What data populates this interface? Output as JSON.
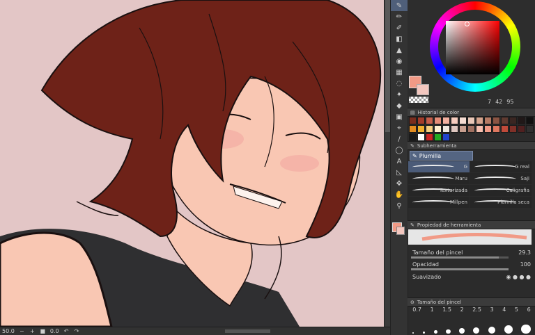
{
  "canvas": {
    "background": "#e3c6c6",
    "hair_color": "#6e2218",
    "skin_color": "#f9c7b3",
    "shirt_color": "#2f2f31"
  },
  "statusbar": {
    "zoom": "50.0",
    "angle": "0.0"
  },
  "color_panel": {
    "main_color": "#f19a86",
    "sub_color": "#f3c7bf",
    "h": "7",
    "s": "42",
    "v": "95"
  },
  "color_history": {
    "title": "Historial de color",
    "swatches": [
      "#7a2d1e",
      "#a23c2a",
      "#c65f4b",
      "#e48c77",
      "#f2b0a0",
      "#f7cdbf",
      "#f5dcd2",
      "#e9c7b7",
      "#d6a58e",
      "#b47a64",
      "#8a5443",
      "#5f3a30",
      "#3a2622",
      "#201818",
      "#111111",
      "#e38c20",
      "#f0b030",
      "#f6d080",
      "#fff0d0",
      "#f0e8e0",
      "#e0c8c0",
      "#c9a090",
      "#a07060",
      "#f7c0b0",
      "#f19a86",
      "#e07860",
      "#c04a3a",
      "#803028",
      "#502020",
      "#303030",
      "#1a1a1a",
      "#ffffff",
      "#cc2222",
      "#22aa22",
      "#2244cc"
    ]
  },
  "subtool": {
    "title": "Subherramienta",
    "active_tab": "Plumilla",
    "brushes": [
      {
        "name": "G",
        "selected": true
      },
      {
        "name": "G real",
        "selected": false
      },
      {
        "name": "Maru",
        "selected": false
      },
      {
        "name": "Saji",
        "selected": false
      },
      {
        "name": "Texturizada",
        "selected": false
      },
      {
        "name": "Caligrafia",
        "selected": false
      },
      {
        "name": "Millpen",
        "selected": false
      },
      {
        "name": "Plumilla seca",
        "selected": false
      }
    ]
  },
  "tool_property": {
    "title": "Propiedad de herramienta",
    "brush_size_label": "Tamaño del pincel",
    "brush_size_value": "29.3",
    "opacity_label": "Opacidad",
    "opacity_value": "100",
    "smoothing_label": "Suavizado",
    "brush_size_fill": 0.9,
    "opacity_fill": 1.0
  },
  "brush_size_panel": {
    "title": "Tamaño del pincel",
    "sizes": [
      "0.7",
      "1",
      "1.5",
      "2",
      "2.5",
      "3",
      "4",
      "5",
      "6"
    ]
  }
}
